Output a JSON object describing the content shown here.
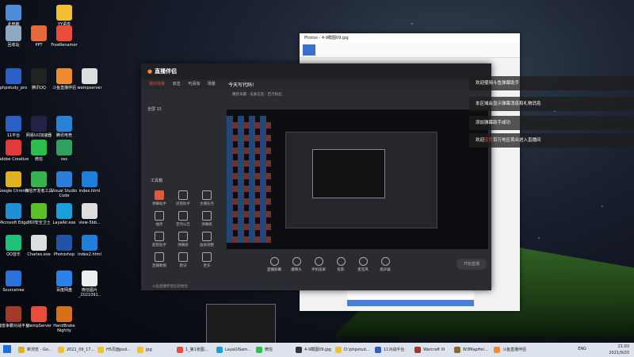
{
  "desktop_icons": [
    {
      "label": "此电脑",
      "color": "#4a8fd8"
    },
    {
      "label": "YY语音",
      "color": "#f0c030"
    },
    {
      "label": "回收站",
      "color": "#8fa9c4"
    },
    {
      "label": "PPT",
      "color": "#e46a3a"
    },
    {
      "label": "FreeRenamer",
      "color": "#e84c3d"
    },
    {
      "label": "phpstudy_pro",
      "color": "#2b5fc4"
    },
    {
      "label": "腾讯QQ",
      "color": "#222"
    },
    {
      "label": "斗鱼直播伴侣",
      "color": "#f08a30"
    },
    {
      "label": "wampserver",
      "color": "#ddd"
    },
    {
      "label": "11平台",
      "color": "#2b5fc4"
    },
    {
      "label": "网易UU加速器",
      "color": "#224"
    },
    {
      "label": "腾讯电竞",
      "color": "#2a82d8"
    },
    {
      "label": "Adobe Creative",
      "color": "#e23a3a"
    },
    {
      "label": "微信",
      "color": "#2dbf4c"
    },
    {
      "label": "oss",
      "color": "#30a060"
    },
    {
      "label": "Google Chrome",
      "color": "#e0b020"
    },
    {
      "label": "微信开发者工具",
      "color": "#37b24d"
    },
    {
      "label": "Visual Studio Code",
      "color": "#2b7fd8"
    },
    {
      "label": "index.html",
      "color": "#1f7fd8"
    },
    {
      "label": "Microsoft Edge",
      "color": "#1f8fd8"
    },
    {
      "label": "360安全卫士",
      "color": "#5bbf2a"
    },
    {
      "label": "LayaAir.exe",
      "color": "#1aa0d8"
    },
    {
      "label": "view-5bb...",
      "color": "#ddd"
    },
    {
      "label": "QQ音乐",
      "color": "#1fc07a"
    },
    {
      "label": "Charles.exe",
      "color": "#ddd"
    },
    {
      "label": "Photoshop",
      "color": "#2452a8"
    },
    {
      "label": "index2.html",
      "color": "#1f7fd8"
    },
    {
      "label": "Sourcetree",
      "color": "#2a72d8"
    },
    {
      "label": "百度网盘",
      "color": "#2b82e8"
    },
    {
      "label": "魔兽争霸对战平台",
      "color": "#a03a2a"
    },
    {
      "label": "WampServer",
      "color": "#e84c3d"
    },
    {
      "label": "HandBrake Nightly",
      "color": "#d8701a"
    },
    {
      "label": "微信图片_2021091..",
      "color": "#eee"
    }
  ],
  "photos_window": {
    "title": "Photos - 4-9截图09.jpg"
  },
  "zhibo": {
    "app_title": "直播伴侣",
    "tabs": [
      "我的场景",
      "双击",
      "可添加",
      "场景"
    ],
    "stream_title": "今天写代码!",
    "line2": "魔兽争霸 · 设备信息 · 百万粉丝",
    "scene_label": "全屏 15",
    "tools_title": "工具箱",
    "tools": [
      "弹幕助手",
      "房管助手",
      "主播任务",
      "抽奖",
      "定时公告",
      "弹幕姬",
      "超管助手",
      "弹幕姬",
      "画质调整",
      "直播数据",
      "歌词",
      "更多"
    ],
    "bottom_buttons": [
      "直播屏幕",
      "摄像头",
      "手机投屏",
      "投影",
      "麦克风",
      "扬声器"
    ],
    "start_label": "开始直播",
    "status": "斗鱼直播伴侣已初始化"
  },
  "danmaku": [
    {
      "text": "欢迎使用斗鱼弹幕助手"
    },
    {
      "text": "本区域会显示弹幕消息和礼物消息"
    },
    {
      "text": "添加弹幕助手成功"
    },
    {
      "pre": "欢迎",
      "name": "蓝色",
      "post": "百万地区观众进入直播间"
    }
  ],
  "taskbar": {
    "items": [
      {
        "label": "新浏览 - Go...",
        "color": "#e0b020"
      },
      {
        "label": "2021_09_17...",
        "color": "#f0c030"
      },
      {
        "label": "H5页面psd...",
        "color": "#f0c030"
      },
      {
        "label": "jpg",
        "color": "#f0c030"
      },
      {
        "label": "1_第1张图...",
        "color": "#e84c3d"
      },
      {
        "label": "LayaUISam...",
        "color": "#1aa0d8"
      },
      {
        "label": "微信",
        "color": "#2dbf4c"
      },
      {
        "label": "4-9截图09.jpg",
        "color": "#333"
      },
      {
        "label": "D:\\phpstud...",
        "color": "#f0c030"
      },
      {
        "label": "11对战平台",
        "color": "#2b5fc4"
      },
      {
        "label": "Warcraft III",
        "color": "#a03a2a"
      },
      {
        "label": "W3MapHel...",
        "color": "#8a6a2a"
      },
      {
        "label": "斗鱼直播伴侣",
        "color": "#f08a30"
      }
    ],
    "time": "21:03",
    "date": "2021/9/20",
    "lang": "ENG"
  }
}
